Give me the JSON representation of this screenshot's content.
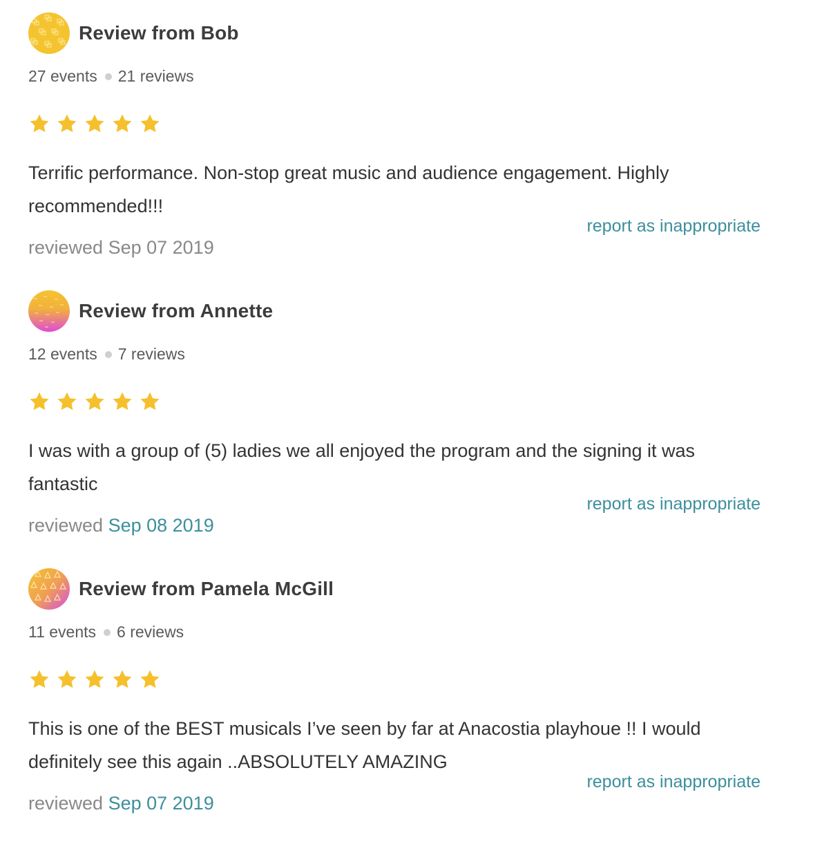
{
  "reviews": [
    {
      "reviewer": "Review from Bob",
      "events": "27 events",
      "reviews_count": "21 reviews",
      "rating": 5,
      "text": "Terrific performance. Non-stop great music and audience engagement. Highly recommended!!!",
      "report_label": "report as inappropriate",
      "reviewed_label": "reviewed",
      "date": "Sep 07 2019",
      "avatar_icon": "yellow-squares-pattern-avatar"
    },
    {
      "reviewer": "Review from Annette",
      "events": "12 events",
      "reviews_count": "7 reviews",
      "rating": 5,
      "text": "I was with a group of (5) ladies we all enjoyed the program and the signing it was fantastic",
      "report_label": "report as inappropriate",
      "reviewed_label": "reviewed",
      "date": "Sep 08 2019",
      "avatar_icon": "yellow-pink-gradient-avatar"
    },
    {
      "reviewer": "Review from Pamela McGill",
      "events": "11 events",
      "reviews_count": "6 reviews",
      "rating": 5,
      "text": "This is one of the BEST musicals I’ve seen by far at Anacostia playhoue !! I would definitely see this again ..ABSOLUTELY AMAZING",
      "report_label": "report as inappropriate",
      "reviewed_label": "reviewed",
      "date": "Sep 07 2019",
      "avatar_icon": "yellow-pink-triangles-avatar"
    }
  ],
  "colors": {
    "star": "#f5c02b",
    "link": "#3c8f9c",
    "muted": "#888888",
    "dot": "#cfcfcf"
  }
}
